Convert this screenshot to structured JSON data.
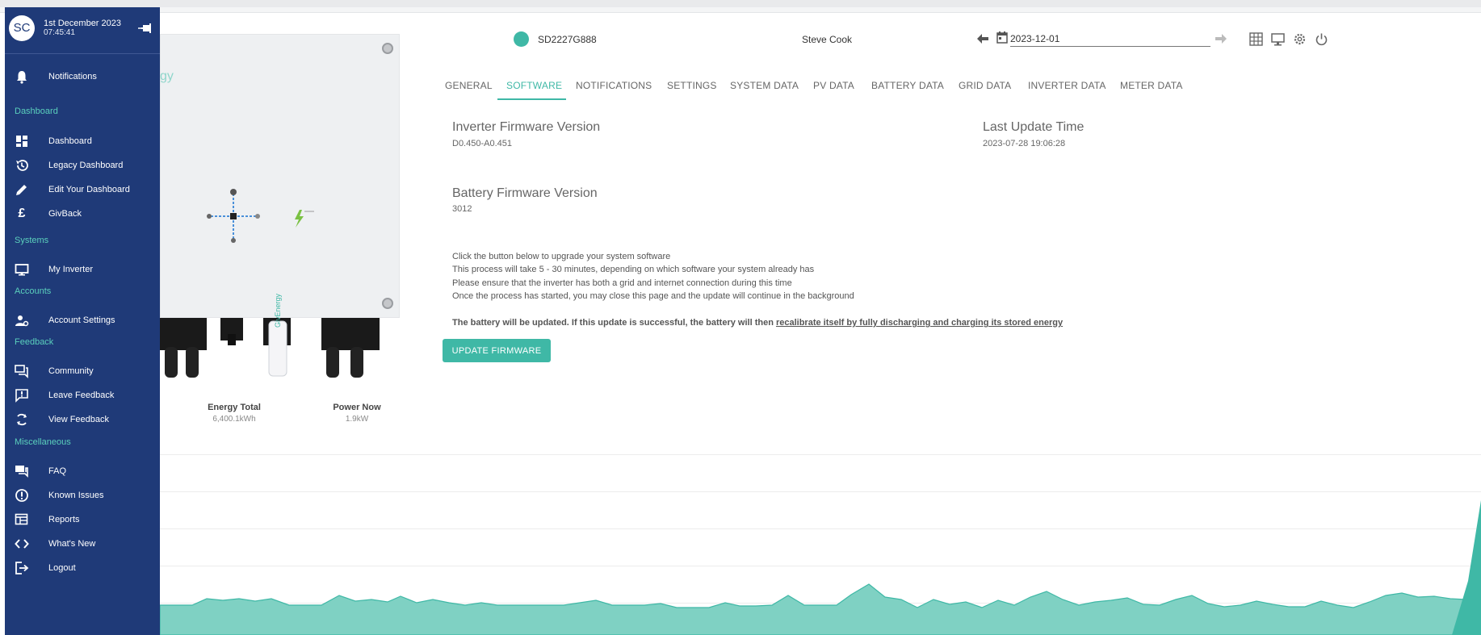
{
  "sidebar": {
    "avatar_initials": "SC",
    "date": "1st December 2023",
    "time": "07:45:41",
    "notifications_label": "Notifications",
    "sections": {
      "dashboard": "Dashboard",
      "systems": "Systems",
      "accounts": "Accounts",
      "feedback": "Feedback",
      "misc": "Miscellaneous"
    },
    "items": {
      "dashboard": "Dashboard",
      "legacy_dashboard": "Legacy Dashboard",
      "edit_dashboard": "Edit Your Dashboard",
      "givback": "GivBack",
      "my_inverter": "My Inverter",
      "account_settings": "Account Settings",
      "community": "Community",
      "leave_feedback": "Leave Feedback",
      "view_feedback": "View Feedback",
      "faq": "FAQ",
      "known_issues": "Known Issues",
      "reports": "Reports",
      "whats_new": "What's New",
      "logout": "Logout"
    }
  },
  "header": {
    "serial": "SD2227G888",
    "user_name": "Steve Cook",
    "date_value": "2023-12-01"
  },
  "tabs": [
    "GENERAL",
    "SOFTWARE",
    "NOTIFICATIONS",
    "SETTINGS",
    "SYSTEM DATA",
    "PV DATA",
    "BATTERY DATA",
    "GRID DATA",
    "INVERTER DATA",
    "METER DATA"
  ],
  "active_tab": "SOFTWARE",
  "software": {
    "inverter_fw_label": "Inverter Firmware Version",
    "inverter_fw_value": "D0.450-A0.451",
    "last_update_label": "Last Update Time",
    "last_update_value": "2023-07-28 19:06:28",
    "battery_fw_label": "Battery Firmware Version",
    "battery_fw_value": "3012",
    "instructions": [
      "Click the button below to upgrade your system software",
      "This process will take 5 - 30 minutes, depending on which software your system already has",
      "Please ensure that the inverter has both a grid and internet connection during this time",
      "Once the process has started, you may close this page and the update will continue in the background"
    ],
    "warning_prefix": "The battery will be updated. If this update is successful, the battery will then ",
    "warning_link": "recalibrate itself by fully discharging and charging its stored energy",
    "update_button": "UPDATE FIRMWARE"
  },
  "inverter_card": {
    "logo_fragment": "gy",
    "energy_total_label": "Energy Total",
    "energy_total_value": "6,400.1kWh",
    "power_now_label": "Power Now",
    "power_now_value": "1.9kW",
    "dongle_text": "GivEnergy"
  },
  "colors": {
    "sidebar_bg": "#1f3a78",
    "accent": "#3fb8a6",
    "section_label": "#5bd0bc",
    "chart_fill": "#7fd1c3"
  }
}
